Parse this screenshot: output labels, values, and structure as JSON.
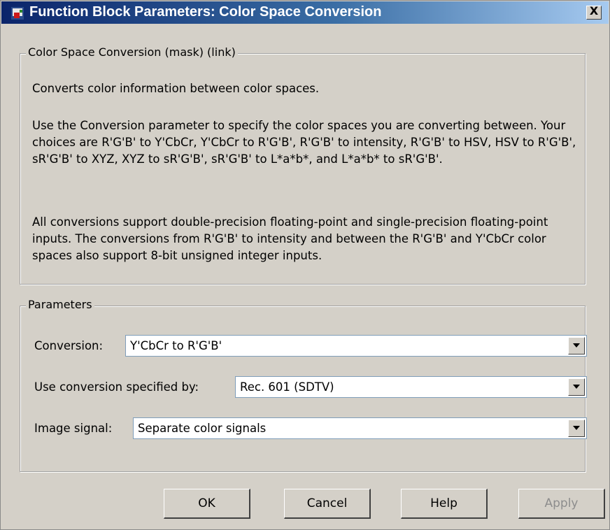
{
  "window": {
    "title": "Function Block Parameters: Color Space Conversion",
    "close_label": "X"
  },
  "description_group": {
    "legend": "Color Space Conversion (mask) (link)",
    "paragraphs": [
      "Converts color information between color spaces.",
      "Use the Conversion parameter to specify the color spaces you are converting between. Your choices are R'G'B' to Y'CbCr, Y'CbCr to R'G'B', R'G'B' to intensity, R'G'B' to HSV, HSV to R'G'B', sR'G'B' to XYZ, XYZ to sR'G'B', sR'G'B' to L*a*b*, and L*a*b* to sR'G'B'.",
      "All conversions support double-precision floating-point and single-precision floating-point inputs. The conversions from R'G'B' to intensity and between the R'G'B' and Y'CbCr color spaces also support 8-bit unsigned integer inputs."
    ]
  },
  "parameters_group": {
    "legend": "Parameters",
    "fields": [
      {
        "label": "Conversion:",
        "value": "Y'CbCr to R'G'B'"
      },
      {
        "label": "Use conversion specified by:",
        "value": "Rec. 601 (SDTV)"
      },
      {
        "label": "Image signal:",
        "value": "Separate color signals"
      }
    ]
  },
  "buttons": {
    "ok": "OK",
    "cancel": "Cancel",
    "help": "Help",
    "apply": "Apply"
  },
  "icons": {
    "app": "simulink-block-icon",
    "close": "close-icon",
    "dropdown": "chevron-down-icon"
  }
}
